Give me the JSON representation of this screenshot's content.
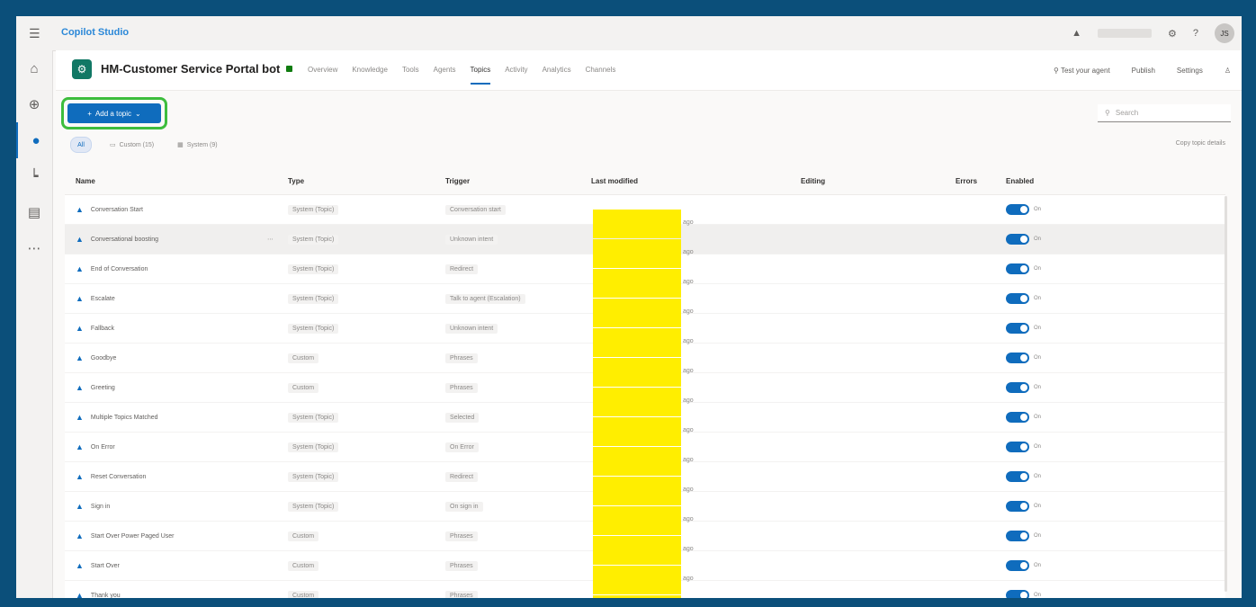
{
  "app": {
    "name": "Copilot Studio"
  },
  "bot": {
    "title": "HM-Customer Service Portal bot"
  },
  "header": {
    "tabs": [
      "Overview",
      "Knowledge",
      "Tools",
      "Agents",
      "Topics",
      "Activity",
      "Analytics",
      "Channels"
    ],
    "active_tab_index": 4,
    "test_label": "Test your agent",
    "publish_label": "Publish",
    "settings_label": "Settings"
  },
  "toolbar": {
    "add_trigger_label": "Add a topic",
    "search_placeholder": "Search",
    "filter_all": "All",
    "filter_custom": "Custom (15)",
    "filter_system": "System (9)",
    "top_right_link": "Copy topic details"
  },
  "table": {
    "headers": [
      "Name",
      "Type",
      "Trigger",
      "Last modified",
      "Editing",
      "Errors",
      "Enabled"
    ],
    "rows": [
      {
        "name": "Conversation Start",
        "type": "System (Topic)",
        "trigger": "Conversation start",
        "mod": "ago",
        "enabled": "On"
      },
      {
        "name": "Conversational boosting",
        "type": "System (Topic)",
        "trigger": "Unknown intent",
        "mod": "ago",
        "enabled": "On"
      },
      {
        "name": "End of Conversation",
        "type": "System (Topic)",
        "trigger": "Redirect",
        "mod": "ago",
        "enabled": "On"
      },
      {
        "name": "Escalate",
        "type": "System (Topic)",
        "trigger": "Talk to agent (Escalation)",
        "mod": "ago",
        "enabled": "On"
      },
      {
        "name": "Fallback",
        "type": "System (Topic)",
        "trigger": "Unknown intent",
        "mod": "ago",
        "enabled": "On"
      },
      {
        "name": "Goodbye",
        "type": "Custom",
        "trigger": "Phrases",
        "mod": "ago",
        "enabled": "On"
      },
      {
        "name": "Greeting",
        "type": "Custom",
        "trigger": "Phrases",
        "mod": "ago",
        "enabled": "On"
      },
      {
        "name": "Multiple Topics Matched",
        "type": "System (Topic)",
        "trigger": "Selected",
        "mod": "ago",
        "enabled": "On"
      },
      {
        "name": "On Error",
        "type": "System (Topic)",
        "trigger": "On Error",
        "mod": "ago",
        "enabled": "On"
      },
      {
        "name": "Reset Conversation",
        "type": "System (Topic)",
        "trigger": "Redirect",
        "mod": "ago",
        "enabled": "On"
      },
      {
        "name": "Sign in",
        "type": "System (Topic)",
        "trigger": "On sign in",
        "mod": "ago",
        "enabled": "On"
      },
      {
        "name": "Start Over Power Paged User",
        "type": "Custom",
        "trigger": "Phrases",
        "mod": "ago",
        "enabled": "On"
      },
      {
        "name": "Start Over",
        "type": "Custom",
        "trigger": "Phrases",
        "mod": "ago",
        "enabled": "On"
      },
      {
        "name": "Thank you",
        "type": "Custom",
        "trigger": "Phrases",
        "mod": "ago",
        "enabled": "On"
      }
    ]
  },
  "colors": {
    "accent": "#0f6cbd",
    "highlight_border": "#3dbd3d",
    "redaction": "#ffee00",
    "frame": "#0b4f7a"
  }
}
